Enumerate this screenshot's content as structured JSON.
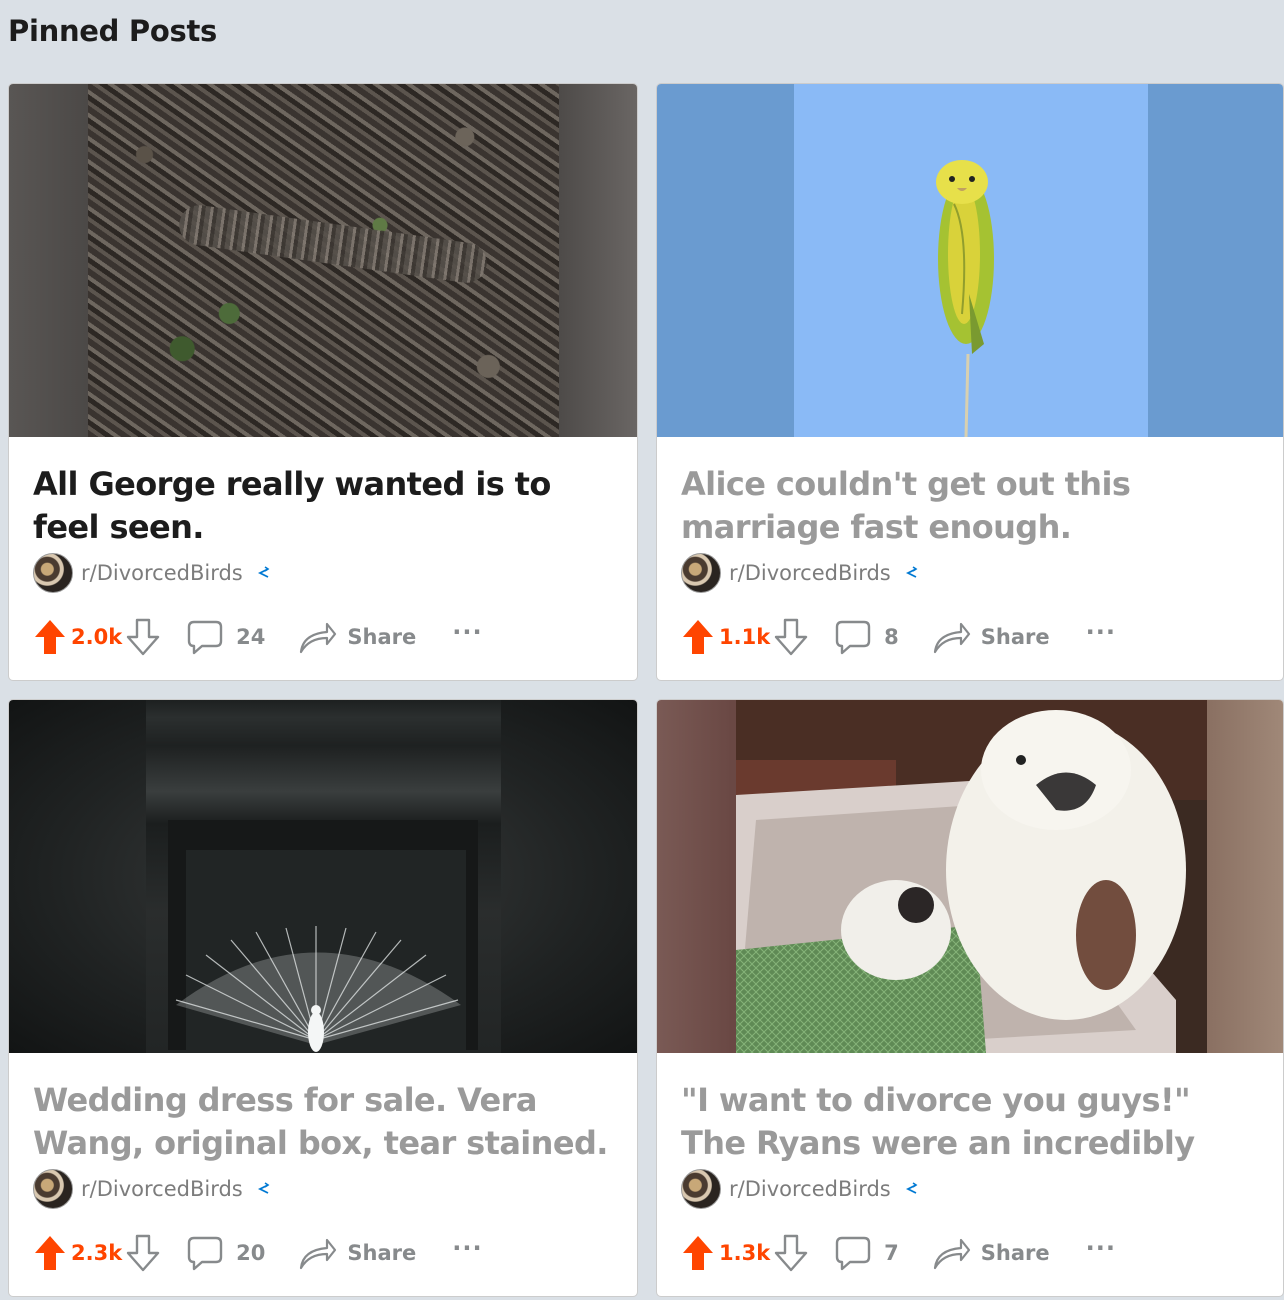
{
  "header": {
    "title": "Pinned Posts"
  },
  "posts": [
    {
      "title": "All George really wanted is to feel seen.",
      "subreddit": "r/DivorcedBirds",
      "votes": "2.0k",
      "comments": "24",
      "share_label": "Share",
      "more_label": "···",
      "visited": false
    },
    {
      "title": "Alice couldn't get out this marriage fast enough.",
      "subreddit": "r/DivorcedBirds",
      "votes": "1.1k",
      "comments": "8",
      "share_label": "Share",
      "more_label": "···",
      "visited": true
    },
    {
      "title": "Wedding dress for sale. Vera Wang, original box, tear stained.",
      "subreddit": "r/DivorcedBirds",
      "votes": "2.3k",
      "comments": "20",
      "share_label": "Share",
      "more_label": "···",
      "visited": true
    },
    {
      "title": "\"I want to divorce you guys!\" The Ryans were an incredibly like-...",
      "subreddit": "r/DivorcedBirds",
      "votes": "1.3k",
      "comments": "7",
      "share_label": "Share",
      "more_label": "···",
      "visited": true
    }
  ],
  "colors": {
    "upvote_active": "#ff4500",
    "meta_gray": "#878a8c",
    "background": "#dae0e6"
  }
}
